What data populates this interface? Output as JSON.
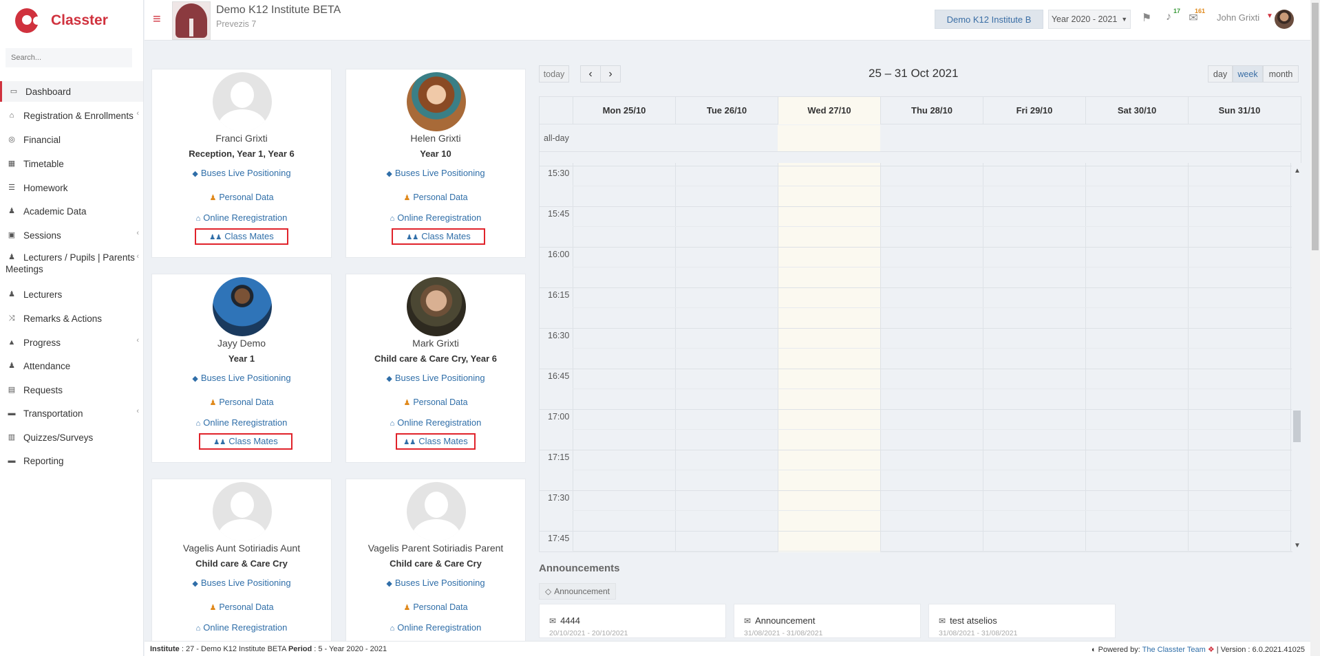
{
  "app": {
    "name": "Classter"
  },
  "sidebar": {
    "search_placeholder": "Search...",
    "items": [
      {
        "label": "Dashboard",
        "icon": "laptop-icon",
        "glyph": "▭"
      },
      {
        "label": "Registration & Enrollments",
        "icon": "institution-icon",
        "glyph": "⌂"
      },
      {
        "label": "Financial",
        "icon": "coins-icon",
        "glyph": "◎"
      },
      {
        "label": "Timetable",
        "icon": "calendar-icon",
        "glyph": "▦"
      },
      {
        "label": "Homework",
        "icon": "list-icon",
        "glyph": "☰"
      },
      {
        "label": "Academic Data",
        "icon": "users-icon",
        "glyph": "♟"
      },
      {
        "label": "Sessions",
        "icon": "chalkboard-icon",
        "glyph": "▣"
      },
      {
        "label_line1": "Lecturers / Pupils | Parents",
        "label_line2": "Meetings",
        "icon": "meeting-icon",
        "glyph": "♟"
      },
      {
        "label": "Lecturers",
        "icon": "teacher-icon",
        "glyph": "♟"
      },
      {
        "label": "Remarks & Actions",
        "icon": "shuffle-icon",
        "glyph": "⤨"
      },
      {
        "label": "Progress",
        "icon": "graduation-cap-icon",
        "glyph": "▲"
      },
      {
        "label": "Attendance",
        "icon": "user-x-icon",
        "glyph": "♟"
      },
      {
        "label": "Requests",
        "icon": "file-icon",
        "glyph": "▤"
      },
      {
        "label": "Transportation",
        "icon": "bus-icon",
        "glyph": "▬"
      },
      {
        "label": "Quizzes/Surveys",
        "icon": "list-check-icon",
        "glyph": "▥"
      },
      {
        "label": "Reporting",
        "icon": "printer-icon",
        "glyph": "▬"
      }
    ]
  },
  "header": {
    "institute_title": "Demo K12 Institute BETA",
    "institute_subtitle": "Prevezis 7",
    "institute_button": "Demo K12 Institute B",
    "year_select": "Year 2020 - 2021",
    "notifications_count": "17",
    "messages_count": "161",
    "user_name": "John Grixti"
  },
  "students": [
    {
      "name": "Franci Grixti",
      "class": "Reception, Year 1, Year 6",
      "photo": "default"
    },
    {
      "name": "Helen Grixti",
      "class": "Year 10",
      "photo": "helen"
    },
    {
      "name": "Jayy Demo",
      "class": "Year 1",
      "photo": "jayy"
    },
    {
      "name": "Mark Grixti",
      "class": "Child care & Care Cry, Year 6",
      "photo": "mark"
    },
    {
      "name": "Vagelis Aunt Sotiriadis Aunt",
      "class": "Child care & Care Cry",
      "photo": "default"
    },
    {
      "name": "Vagelis Parent Sotiriadis Parent",
      "class": "Child care & Care Cry",
      "photo": "default"
    }
  ],
  "card_links": {
    "buses": "Buses Live Positioning",
    "personal": "Personal Data",
    "rereg": "Online Reregistration",
    "classmates": "Class Mates"
  },
  "calendar": {
    "today_label": "today",
    "prev_glyph": "‹",
    "next_glyph": "›",
    "title": "25 – 31 Oct 2021",
    "views": [
      "day",
      "week",
      "month"
    ],
    "active_view": "week",
    "allday_label": "all-day",
    "days": [
      "Mon 25/10",
      "Tue 26/10",
      "Wed 27/10",
      "Thu 28/10",
      "Fri 29/10",
      "Sat 30/10",
      "Sun 31/10"
    ],
    "today_index": 2,
    "times": [
      "15:30",
      "15:45",
      "16:00",
      "16:15",
      "16:30",
      "16:45",
      "17:00",
      "17:15",
      "17:30",
      "17:45"
    ]
  },
  "announcements": {
    "title": "Announcements",
    "tag": "Announcement",
    "items": [
      {
        "title": "4444",
        "dates": "20/10/2021 - 20/10/2021",
        "icon": "envelope-icon"
      },
      {
        "title": "Announcement",
        "dates": "31/08/2021 - 31/08/2021",
        "icon": "envelope-open-icon"
      },
      {
        "title": "test atselios",
        "dates": "31/08/2021 - 31/08/2021",
        "icon": "envelope-open-icon"
      }
    ]
  },
  "footer": {
    "institute_label": "Institute",
    "institute_value": ": 27 - Demo K12 Institute BETA",
    "period_label": "Period",
    "period_value": ": 5 - Year 2020 - 2021",
    "powered_label": "Powered by:",
    "powered_link": "The Classter Team",
    "version": "| Version : 6.0.2021.41025"
  },
  "colors": {
    "brand": "#d0323e",
    "link": "#2f6ea8",
    "highlight_box": "#e0222a"
  }
}
